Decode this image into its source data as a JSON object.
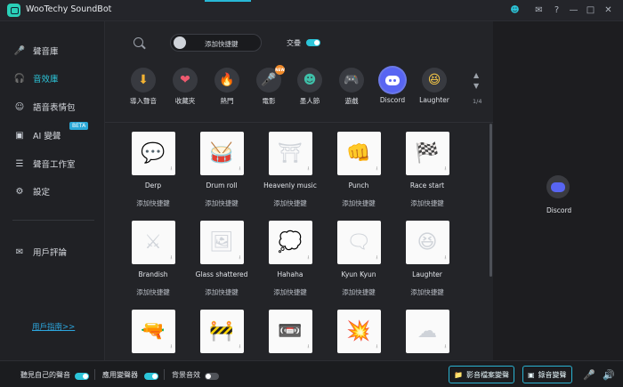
{
  "app": {
    "title": "WooTechy SoundBot"
  },
  "titlebar": {
    "icons": [
      "user-icon",
      "mail-icon",
      "help-icon",
      "minimize-icon",
      "maximize-icon",
      "close-icon"
    ]
  },
  "sidebar": {
    "items": [
      {
        "label": "聲音庫",
        "icon": "microphone-icon"
      },
      {
        "label": "音效庫",
        "icon": "headphones-icon",
        "active": true
      },
      {
        "label": "語音表情包",
        "icon": "smiley-icon"
      },
      {
        "label": "AI 變聲",
        "icon": "ai-voice-icon",
        "badge": "BETA"
      },
      {
        "label": "聲音工作室",
        "icon": "sliders-icon"
      },
      {
        "label": "設定",
        "icon": "settings-icon"
      },
      {
        "label": "用戶評論",
        "icon": "comment-icon"
      }
    ],
    "guide_link": "用戶指南>>"
  },
  "toolbar": {
    "hotkey_placeholder": "添加快捷鍵",
    "overlap_label": "交疊",
    "overlap_on": true
  },
  "categories": [
    {
      "label": "導入聲音",
      "icon": "import-icon",
      "color": "#f2b233"
    },
    {
      "label": "收藏夾",
      "icon": "heart-icon",
      "color": "#ee5a6f"
    },
    {
      "label": "熱門",
      "icon": "fire-icon",
      "color": "#ff6a2b"
    },
    {
      "label": "電影",
      "icon": "mic-stand-icon",
      "color": "#7b7e86",
      "badge": "NEW"
    },
    {
      "label": "墨人節",
      "icon": "clown-icon",
      "color": "#3fc0a9"
    },
    {
      "label": "遊戲",
      "icon": "gamepad-icon",
      "color": "#d6dae3"
    },
    {
      "label": "Discord",
      "icon": "discord-icon",
      "color": "#5865f2",
      "selected": true
    },
    {
      "label": "Laughter",
      "icon": "laugh-emoji-icon",
      "color": "#f7c948"
    }
  ],
  "pager": {
    "text": "1/4"
  },
  "sounds": [
    {
      "name": "Derp",
      "hotkey": "添加快捷鍵",
      "icon": "derp-icon",
      "glyph": "💬"
    },
    {
      "name": "Drum roll",
      "hotkey": "添加快捷鍵",
      "icon": "drum-icon",
      "glyph": "🥁"
    },
    {
      "name": "Heavenly music",
      "hotkey": "添加快捷鍵",
      "icon": "heaven-gate-icon",
      "glyph": "⛩"
    },
    {
      "name": "Punch",
      "hotkey": "添加快捷鍵",
      "icon": "punch-icon",
      "glyph": "👊"
    },
    {
      "name": "Race start",
      "hotkey": "添加快捷鍵",
      "icon": "checkered-flag-icon",
      "glyph": "🏁"
    },
    {
      "name": "Brandish",
      "hotkey": "添加快捷鍵",
      "icon": "swords-icon",
      "glyph": "⚔"
    },
    {
      "name": "Glass shattered",
      "hotkey": "添加快捷鍵",
      "icon": "broken-screen-icon",
      "glyph": "🖼"
    },
    {
      "name": "Hahaha",
      "hotkey": "添加快捷鍵",
      "icon": "haha-bubble-icon",
      "glyph": "💭"
    },
    {
      "name": "Kyun Kyun",
      "hotkey": "添加快捷鍵",
      "icon": "kyun-bubble-icon",
      "glyph": "🗨"
    },
    {
      "name": "Laughter",
      "hotkey": "添加快捷鍵",
      "icon": "laughing-face-icon",
      "glyph": "😆"
    },
    {
      "name": "",
      "hotkey": "",
      "icon": "gun-icon",
      "glyph": "🔫"
    },
    {
      "name": "",
      "hotkey": "",
      "icon": "ready-banner-icon",
      "glyph": "🚧"
    },
    {
      "name": "",
      "hotkey": "",
      "icon": "cassette-icon",
      "glyph": "📼"
    },
    {
      "name": "",
      "hotkey": "",
      "icon": "explosion-icon",
      "glyph": "💥"
    },
    {
      "name": "",
      "hotkey": "",
      "icon": "mushroom-cloud-icon",
      "glyph": "☁"
    }
  ],
  "right_panel": {
    "label": "Discord"
  },
  "bottombar": {
    "hear_self": "聽見自己的聲音",
    "hear_self_on": true,
    "apply_changer": "應用變聲器",
    "apply_changer_on": true,
    "bg_sound": "背景音效",
    "bg_sound_on": false,
    "video_file_btn": "影音檔案變聲",
    "record_btn": "錄音變聲"
  }
}
